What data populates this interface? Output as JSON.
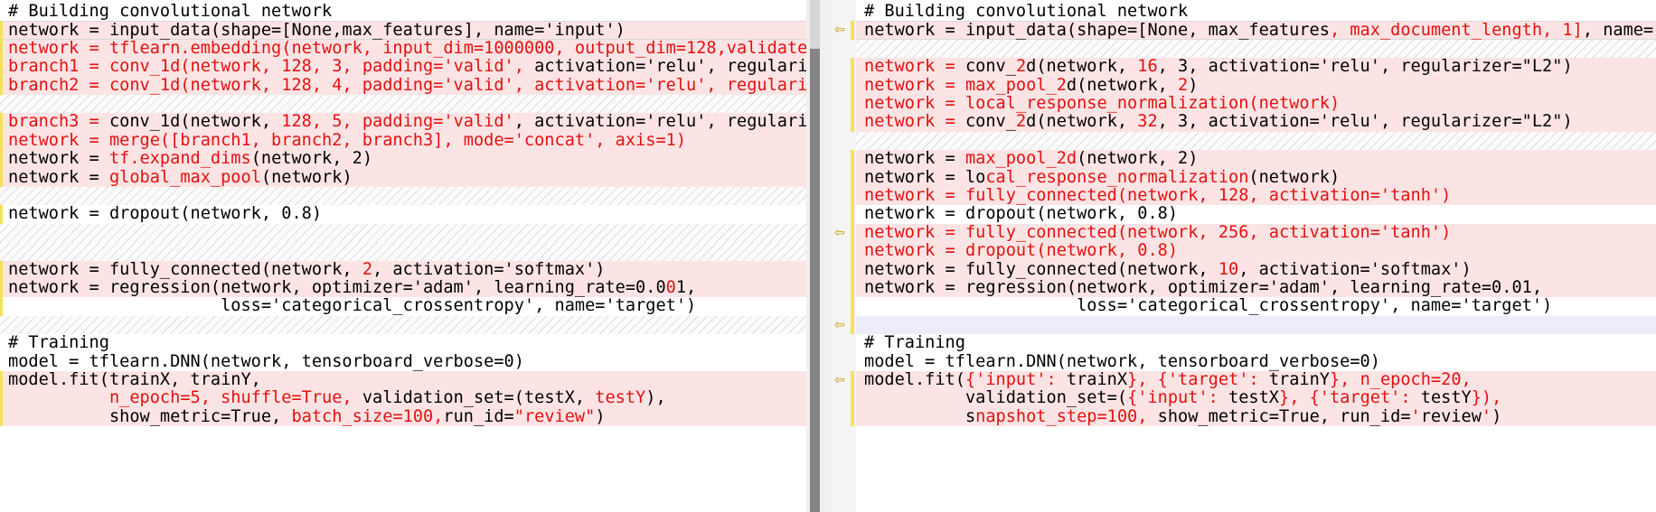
{
  "left": {
    "lines": [
      {
        "type": "normal",
        "segs": [
          {
            "t": "# Building convolutional network",
            "c": "k"
          }
        ]
      },
      {
        "type": "changed",
        "cursor": true,
        "segs": [
          {
            "t": "network = input_data(shape=[None,max_features], name='input')",
            "c": "k"
          }
        ]
      },
      {
        "type": "changed",
        "segs": [
          {
            "t": "network = tflearn.embedding(network, input_dim=1000000, output_dim=128,validate_",
            "c": "r"
          }
        ]
      },
      {
        "type": "changed",
        "segs": [
          {
            "t": "branch1 = conv_1d(network, 1",
            "c": "r"
          },
          {
            "t": "28, 3, ",
            "c": "r"
          },
          {
            "t": "padding='valid', ",
            "c": "r"
          },
          {
            "t": "activation='relu', regulariz",
            "c": "k"
          }
        ]
      },
      {
        "type": "changed",
        "segs": [
          {
            "t": "branch2 = conv_1d(network, 128, 4, padding='valid', activation='relu', regulariz",
            "c": "r"
          }
        ]
      },
      {
        "type": "filler"
      },
      {
        "type": "changed",
        "segs": [
          {
            "t": "branch3 = ",
            "c": "r"
          },
          {
            "t": "conv_1d(network, ",
            "c": "k"
          },
          {
            "t": "128, 5, padding='valid'",
            "c": "r"
          },
          {
            "t": ", activation='relu', regulariz",
            "c": "k"
          }
        ]
      },
      {
        "type": "changed",
        "segs": [
          {
            "t": "network = merge([branch1, branch2, branch3], mode='concat', axis=1)",
            "c": "r"
          }
        ]
      },
      {
        "type": "changed",
        "segs": [
          {
            "t": "network = ",
            "c": "k"
          },
          {
            "t": "tf.expand_dims",
            "c": "r"
          },
          {
            "t": "(network, 2)",
            "c": "k"
          }
        ]
      },
      {
        "type": "changed",
        "segs": [
          {
            "t": "network = ",
            "c": "k"
          },
          {
            "t": "glo",
            "c": "r"
          },
          {
            "t": "bal_max_po",
            "c": "r"
          },
          {
            "t": "ol",
            "c": "r"
          },
          {
            "t": "(network)",
            "c": "k"
          }
        ]
      },
      {
        "type": "filler"
      },
      {
        "type": "blank",
        "segs": [
          {
            "t": "network = dropout(network, 0.8)",
            "c": "k"
          }
        ]
      },
      {
        "type": "filler"
      },
      {
        "type": "filler"
      },
      {
        "type": "changed",
        "segs": [
          {
            "t": "network = fully_connected(network, ",
            "c": "k"
          },
          {
            "t": "2",
            "c": "r"
          },
          {
            "t": ", activation='softmax')",
            "c": "k"
          }
        ]
      },
      {
        "type": "changed",
        "segs": [
          {
            "t": "network = regression(network, optimizer='adam', learning_rate=0.0",
            "c": "k"
          },
          {
            "t": "0",
            "c": "r"
          },
          {
            "t": "1,",
            "c": "k"
          }
        ]
      },
      {
        "type": "blank",
        "segs": [
          {
            "t": "                     loss='categorical_crossentropy', name='target')",
            "c": "k"
          }
        ]
      },
      {
        "type": "filler"
      },
      {
        "type": "normal",
        "segs": [
          {
            "t": "# Training",
            "c": "k"
          }
        ]
      },
      {
        "type": "normal",
        "segs": [
          {
            "t": "model = tflearn.DNN(network, tensorboard_verbose=0)",
            "c": "k"
          }
        ]
      },
      {
        "type": "changed",
        "segs": [
          {
            "t": "model.fit(trainX, trainY,",
            "c": "k"
          }
        ]
      },
      {
        "type": "changed",
        "segs": [
          {
            "t": "          ",
            "c": "k"
          },
          {
            "t": "n_epoch=5, shuffle=True,",
            "c": "r"
          },
          {
            "t": " validation_set=(testX, ",
            "c": "k"
          },
          {
            "t": "testY",
            "c": "r"
          },
          {
            "t": "),",
            "c": "k"
          }
        ]
      },
      {
        "type": "changed",
        "segs": [
          {
            "t": "          show_metric=True, ",
            "c": "k"
          },
          {
            "t": "batch_size=100,",
            "c": "r"
          },
          {
            "t": "run_id=",
            "c": "k"
          },
          {
            "t": "\"review\"",
            "c": "r"
          },
          {
            "t": ")",
            "c": "k"
          }
        ]
      }
    ]
  },
  "right": {
    "lines": [
      {
        "type": "normal",
        "segs": [
          {
            "t": "# Building convolutional network",
            "c": "k"
          }
        ]
      },
      {
        "type": "changed",
        "cursor": true,
        "segs": [
          {
            "t": "network = input_data(shape=[None, max_features",
            "c": "k"
          },
          {
            "t": ", max_document_length, 1]",
            "c": "r"
          },
          {
            "t": ", name='i",
            "c": "k"
          }
        ]
      },
      {
        "type": "filler"
      },
      {
        "type": "changed",
        "segs": [
          {
            "t": "network = ",
            "c": "r"
          },
          {
            "t": "conv_",
            "c": "k"
          },
          {
            "t": "2",
            "c": "r"
          },
          {
            "t": "d(network, ",
            "c": "k"
          },
          {
            "t": "16",
            "c": "r"
          },
          {
            "t": ", 3, activation='relu', regularizer=\"L2\")",
            "c": "k"
          }
        ]
      },
      {
        "type": "changed",
        "segs": [
          {
            "t": "network = ",
            "c": "r"
          },
          {
            "t": "max_pool_2",
            "c": "r"
          },
          {
            "t": "d(network, ",
            "c": "k"
          },
          {
            "t": "2",
            "c": "r"
          },
          {
            "t": ")",
            "c": "k"
          }
        ]
      },
      {
        "type": "changed",
        "segs": [
          {
            "t": "network = local_response_normalization(network)",
            "c": "r"
          }
        ]
      },
      {
        "type": "changed",
        "segs": [
          {
            "t": "network = ",
            "c": "r"
          },
          {
            "t": "conv_",
            "c": "k"
          },
          {
            "t": "2",
            "c": "r"
          },
          {
            "t": "d(network, ",
            "c": "k"
          },
          {
            "t": "32",
            "c": "r"
          },
          {
            "t": ", 3, activation='relu', regularizer=\"L2\")",
            "c": "k"
          }
        ]
      },
      {
        "type": "filler"
      },
      {
        "type": "changed",
        "segs": [
          {
            "t": "network = ",
            "c": "k"
          },
          {
            "t": "max_pool_2d",
            "c": "r"
          },
          {
            "t": "(network, 2)",
            "c": "k"
          }
        ]
      },
      {
        "type": "changed",
        "segs": [
          {
            "t": "network = ",
            "c": "k"
          },
          {
            "t": "lo",
            "c": "k"
          },
          {
            "t": "cal_respo",
            "c": "r"
          },
          {
            "t": "nse_normalization",
            "c": "r"
          },
          {
            "t": "(network)",
            "c": "k"
          }
        ]
      },
      {
        "type": "changed",
        "segs": [
          {
            "t": "network = fully_connected(network, 128, activation='tanh')",
            "c": "r"
          }
        ]
      },
      {
        "type": "blank",
        "segs": [
          {
            "t": "network = dropout(network, 0.8)",
            "c": "k"
          }
        ]
      },
      {
        "type": "changed",
        "segs": [
          {
            "t": "network = fully_connected(network, 256, activation='tanh')",
            "c": "r"
          }
        ]
      },
      {
        "type": "changed",
        "segs": [
          {
            "t": "network = dropout(network, 0.8)",
            "c": "r"
          }
        ]
      },
      {
        "type": "changed",
        "segs": [
          {
            "t": "network = fully_connected(network, ",
            "c": "k"
          },
          {
            "t": "10",
            "c": "r"
          },
          {
            "t": ", activation='softmax')",
            "c": "k"
          }
        ]
      },
      {
        "type": "changed",
        "segs": [
          {
            "t": "network = regression(network, optimizer='adam', learning_rate=0.01,",
            "c": "k"
          }
        ]
      },
      {
        "type": "blank",
        "segs": [
          {
            "t": "                     loss='categorical_crossentropy', name='target')",
            "c": "k"
          }
        ]
      },
      {
        "type": "conflict",
        "segs": [
          {
            "t": "",
            "c": "k"
          }
        ]
      },
      {
        "type": "normal",
        "segs": [
          {
            "t": "# Training",
            "c": "k"
          }
        ]
      },
      {
        "type": "normal",
        "segs": [
          {
            "t": "model = tflearn.DNN(network, tensorboard_verbose=0)",
            "c": "k"
          }
        ]
      },
      {
        "type": "changed",
        "segs": [
          {
            "t": "model.fit(",
            "c": "k"
          },
          {
            "t": "{'input': ",
            "c": "r"
          },
          {
            "t": "trainX",
            "c": "k"
          },
          {
            "t": "}, {'target': ",
            "c": "r"
          },
          {
            "t": "trainY",
            "c": "k"
          },
          {
            "t": "}, n_epoch=20,",
            "c": "r"
          }
        ]
      },
      {
        "type": "changed",
        "segs": [
          {
            "t": "          ",
            "c": "k"
          },
          {
            "t": "validation_set=(",
            "c": "k"
          },
          {
            "t": "{'input': ",
            "c": "r"
          },
          {
            "t": "testX",
            "c": "k"
          },
          {
            "t": "}, {'target': ",
            "c": "r"
          },
          {
            "t": "testY",
            "c": "k"
          },
          {
            "t": "}),",
            "c": "r"
          }
        ]
      },
      {
        "type": "changed",
        "segs": [
          {
            "t": "          s",
            "c": "k"
          },
          {
            "t": "napshot_step=100,",
            "c": "r"
          },
          {
            "t": " show_metric=True, run_id=",
            "c": "k"
          },
          {
            "t": "'",
            "c": "r"
          },
          {
            "t": "review",
            "c": "k"
          },
          {
            "t": "'",
            "c": "r"
          },
          {
            "t": ")",
            "c": "k"
          }
        ]
      }
    ]
  },
  "arrow_icon": "merge-left-arrow-icon",
  "colors": {
    "changed": "#fde4e4",
    "removed_text": "#e41010",
    "gutter_mark": "#f5e15a"
  }
}
